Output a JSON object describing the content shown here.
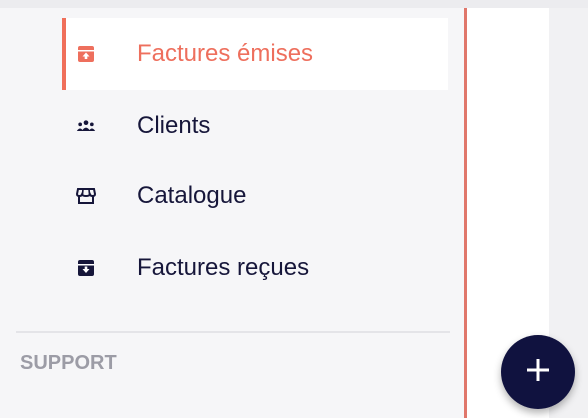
{
  "sidebar": {
    "items": [
      {
        "label": "Factures émises",
        "icon": "inbox-upload-icon",
        "active": true
      },
      {
        "label": "Clients",
        "icon": "users-group-icon",
        "active": false
      },
      {
        "label": "Catalogue",
        "icon": "storefront-icon",
        "active": false
      },
      {
        "label": "Factures reçues",
        "icon": "inbox-download-icon",
        "active": false
      }
    ],
    "section_label": "SUPPORT"
  },
  "fab": {
    "icon": "plus-icon"
  },
  "colors": {
    "accent": "#ee6f5d",
    "text": "#16163a",
    "fab": "#10123f",
    "section_label": "#9c9ca6"
  }
}
